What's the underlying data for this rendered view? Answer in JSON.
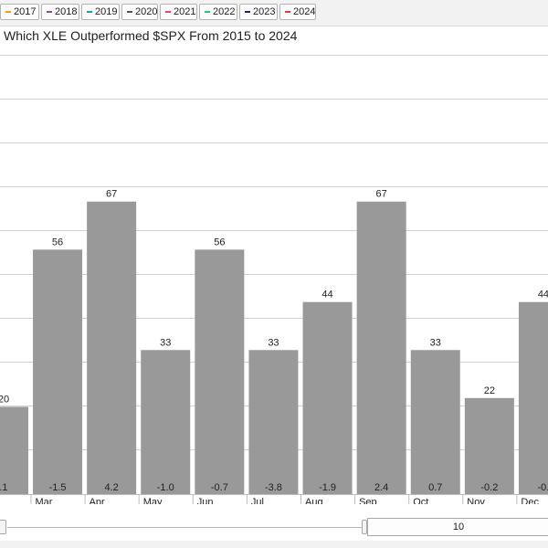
{
  "legend": {
    "items": [
      {
        "label": "2017",
        "color": "#f39c12"
      },
      {
        "label": "2018",
        "color": "#8e44ad"
      },
      {
        "label": "2019",
        "color": "#17a2b8"
      },
      {
        "label": "2020",
        "color": "#555555"
      },
      {
        "label": "2021",
        "color": "#e83e8c"
      },
      {
        "label": "2022",
        "color": "#28c76f"
      },
      {
        "label": "2023",
        "color": "#1a237e"
      },
      {
        "label": "2024",
        "color": "#e53935"
      }
    ]
  },
  "title": "Which XLE Outperformed $SPX From 2015 to 2024",
  "navigator": {
    "window_label": "10"
  },
  "chart_data": {
    "type": "bar",
    "categories": [
      "",
      "Mar",
      "Apr",
      "May",
      "Jun",
      "Jul",
      "Aug",
      "Sep",
      "Oct",
      "Nov",
      "Dec"
    ],
    "values": [
      20,
      56,
      67,
      33,
      56,
      33,
      44,
      67,
      33,
      22,
      44
    ],
    "top_labels": [
      "20",
      "56",
      "67",
      "33",
      "56",
      "33",
      "44",
      "67",
      "33",
      "22",
      "44"
    ],
    "bottom_labels": [
      ".1",
      "-1.5",
      "4.2",
      "-1.0",
      "-0.7",
      "-3.8",
      "-1.9",
      "2.4",
      "0.7",
      "-0.2",
      "-0."
    ],
    "bar_color": "#999999",
    "grid": true
  }
}
